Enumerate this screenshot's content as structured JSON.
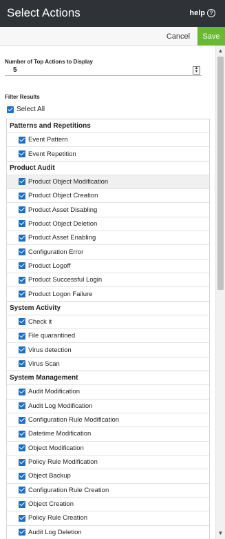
{
  "header": {
    "title": "Select Actions",
    "help_label": "help"
  },
  "actionbar": {
    "cancel_label": "Cancel",
    "save_label": "Save"
  },
  "top_actions": {
    "label": "Number of Top Actions to Display",
    "value": "5"
  },
  "filter": {
    "label": "Filter Results",
    "select_all_label": "Select All",
    "groups": [
      {
        "title": "Patterns and Repetitions",
        "items": [
          "Event Pattern",
          "Event Repetition"
        ]
      },
      {
        "title": "Product Audit",
        "items": [
          "Product Object Modification",
          "Product Object Creation",
          "Product Asset Disabling",
          "Product Object Deletion",
          "Product Asset Enabling",
          "Configuration Error",
          "Product Logoff",
          "Product Successful Login",
          "Product Logon Failure"
        ]
      },
      {
        "title": "System Activity",
        "items": [
          "Check it",
          "File quarantined",
          "Virus detection",
          "Virus Scan"
        ]
      },
      {
        "title": "System Management",
        "items": [
          "Audit Modification",
          "Audit Log Modification",
          "Configuration Rule Modification",
          "Datetime Modification",
          "Object Modification",
          "Policy Rule Modification",
          "Object Backup",
          "Configuration Rule Creation",
          "Object Creation",
          "Policy Rule Creation",
          "Audit Log Deletion"
        ]
      }
    ]
  },
  "icons": {
    "help": "question-circle-icon",
    "checkbox": "checkbox-checked-icon",
    "spinner": "spinner-arrows-icon"
  },
  "colors": {
    "header_bg": "#2f3337",
    "save_bg": "#69b935",
    "checkbox": "#1f6fbf"
  }
}
